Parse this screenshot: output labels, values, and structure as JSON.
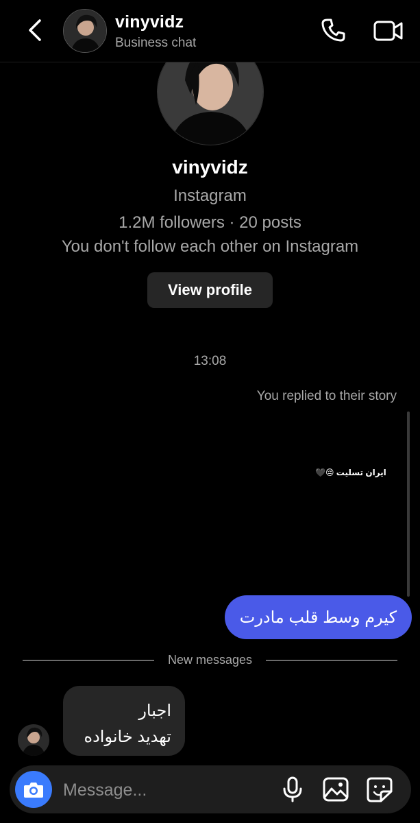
{
  "header": {
    "username": "vinyvidz",
    "subtitle": "Business chat",
    "icons": {
      "back": "chevron-left-icon",
      "call": "phone-icon",
      "video": "video-camera-icon"
    }
  },
  "profile": {
    "name": "vinyvidz",
    "platform": "Instagram",
    "stats": "1.2M followers · 20 posts",
    "relationship": "You don't follow each other on Instagram",
    "view_profile_label": "View profile"
  },
  "conversation": {
    "timestamp": "13:08",
    "reply_label": "You replied to their story",
    "story_caption": "ایران تسلیت 😔🖤",
    "sent_message": "کیرم وسط قلب مادرت",
    "divider_label": "New messages",
    "received_lines": [
      "اجبار",
      "تهدید خانواده"
    ]
  },
  "composer": {
    "placeholder": "Message...",
    "icons": {
      "camera": "camera-icon",
      "mic": "microphone-icon",
      "gallery": "image-icon",
      "sticker": "sticker-icon"
    }
  },
  "colors": {
    "background": "#000000",
    "sent_bubble": "#4a5ae8",
    "received_bubble": "#262626",
    "camera_button": "#3a7bfd",
    "secondary_text": "#a8a8a8"
  }
}
